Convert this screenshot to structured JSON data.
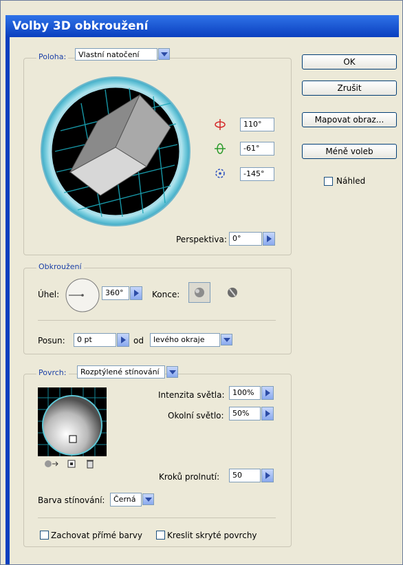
{
  "dialog": {
    "title": "Volby 3D obkroužení"
  },
  "buttons": {
    "ok": "OK",
    "cancel": "Zrušit",
    "map_art": "Mapovat obraz...",
    "fewer_options": "Méně voleb"
  },
  "preview": {
    "label": "Náhled",
    "checked": false
  },
  "position": {
    "legend": "Poloha:",
    "preset": "Vlastní natočení",
    "rotate_x": "110°",
    "rotate_y": "-61°",
    "rotate_z": "-145°",
    "perspective_label": "Perspektiva:",
    "perspective_value": "0°"
  },
  "revolve": {
    "legend": "Obkroužení",
    "angle_label": "Úhel:",
    "angle_value": "360°",
    "cap_label": "Konce:",
    "offset_label": "Posun:",
    "offset_value": "0 pt",
    "from_label": "od",
    "from_value": "levého okraje"
  },
  "surface": {
    "legend": "Povrch:",
    "type": "Rozptýlené stínování",
    "light_intensity_label": "Intenzita světla:",
    "light_intensity_value": "100%",
    "ambient_label": "Okolní světlo:",
    "ambient_value": "50%",
    "blend_steps_label": "Kroků prolnutí:",
    "blend_steps_value": "50",
    "shading_color_label": "Barva stínování:",
    "shading_color_value": "Černá",
    "preserve_spot_label": "Zachovat přímé barvy",
    "draw_hidden_label": "Kreslit skryté povrchy"
  },
  "colors": {
    "accent": "#0a3fbf",
    "rotate_x": "#d42a2a",
    "rotate_y": "#2a9a2a",
    "rotate_z": "#2a4fbf"
  },
  "icons": [
    "rotate-x-icon",
    "rotate-y-icon",
    "rotate-z-icon",
    "cap-on-icon",
    "cap-off-icon",
    "move-light-back-icon",
    "new-light-icon",
    "delete-light-icon"
  ]
}
